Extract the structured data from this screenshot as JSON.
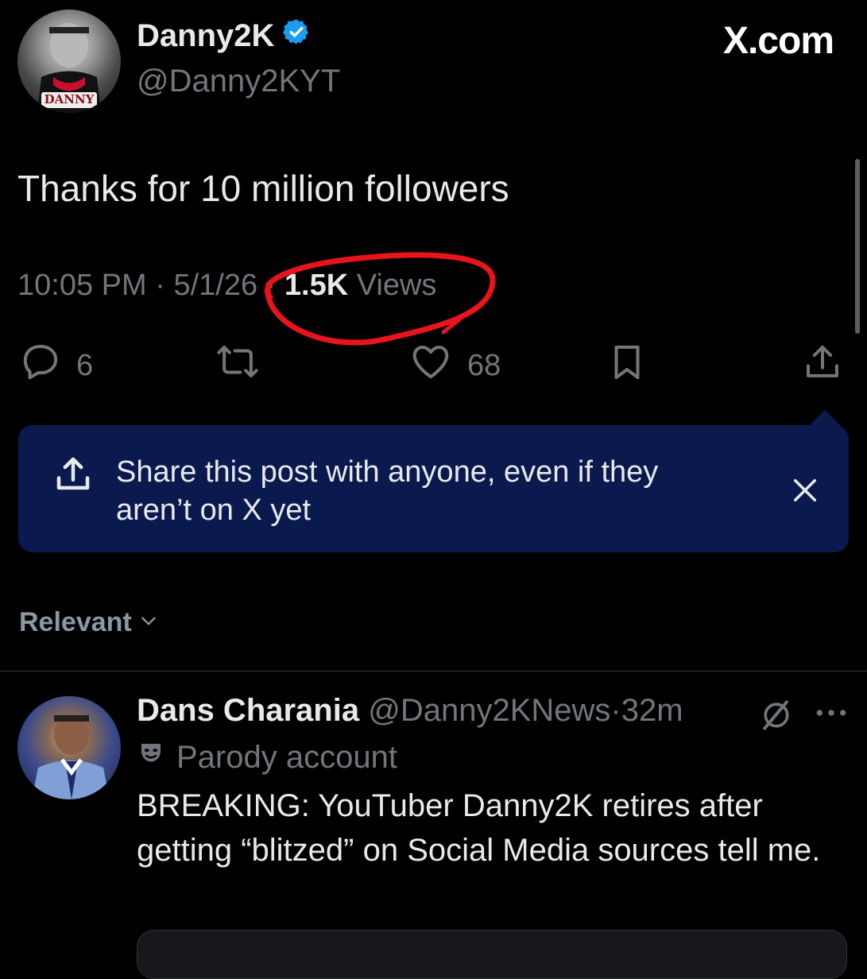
{
  "post": {
    "author_name": "Danny2K",
    "author_handle": "@Danny2KYT",
    "avatar_caption": "DANNY",
    "brand": "X.com",
    "text": "Thanks for 10 million followers",
    "time": "10:05 PM",
    "date": "5/1/26",
    "views_count": "1.5K",
    "views_label": "Views",
    "separator": "·"
  },
  "actions": {
    "replies": "6",
    "likes": "68"
  },
  "share_banner": {
    "text": "Share this post with anyone, even if they aren’t on X yet"
  },
  "sort": {
    "label": "Relevant"
  },
  "reply": {
    "name": "Dans Charania",
    "handle": "@Danny2KNews",
    "separator": "·",
    "time": "32m",
    "parody_label": "Parody account",
    "text": "BREAKING: YouTuber Danny2K retires after getting “blitzed” on Social Media sources tell me."
  },
  "colors": {
    "background": "#000000",
    "text_primary": "#e7e9ea",
    "text_secondary": "#71767b",
    "verified_blue": "#1d9bf0",
    "banner_bg": "#0b1a4e",
    "annotation_red": "#e8141c"
  },
  "icons": [
    "verified-badge-icon",
    "reply-icon",
    "retweet-icon",
    "like-icon",
    "bookmark-icon",
    "share-icon",
    "close-icon",
    "chevron-down-icon",
    "grok-icon",
    "more-icon",
    "parody-mask-icon"
  ]
}
